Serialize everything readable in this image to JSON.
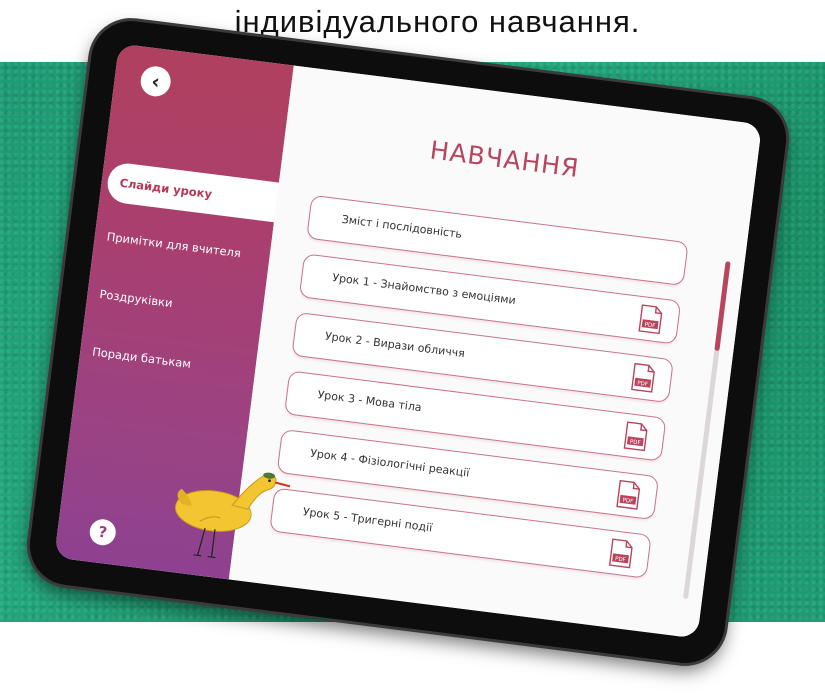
{
  "caption": "індивідуального навчання.",
  "app": {
    "title": "НАВЧАННЯ",
    "sidebar": {
      "items": [
        {
          "label": "Слайди уроку",
          "active": true
        },
        {
          "label": "Примітки для вчителя",
          "active": false
        },
        {
          "label": "Роздруківки",
          "active": false
        },
        {
          "label": "Поради батькам",
          "active": false
        }
      ],
      "help": "?"
    },
    "lessons": [
      {
        "label": "Зміст і послідовність",
        "has_pdf": false
      },
      {
        "label": "Урок 1 - Знайомство з емоціями",
        "has_pdf": true
      },
      {
        "label": "Урок 2 - Вирази обличчя",
        "has_pdf": true
      },
      {
        "label": "Урок 3 - Мова тіла",
        "has_pdf": true
      },
      {
        "label": "Урок 4 - Фізіологічні реакції",
        "has_pdf": true
      },
      {
        "label": "Урок 5 - Тригерні події",
        "has_pdf": true
      }
    ],
    "pdf_label": "PDF"
  },
  "colors": {
    "accent": "#b8445d",
    "sidebar_top": "#b0405f",
    "sidebar_bottom": "#8e4190",
    "background": "#1c9a73"
  }
}
